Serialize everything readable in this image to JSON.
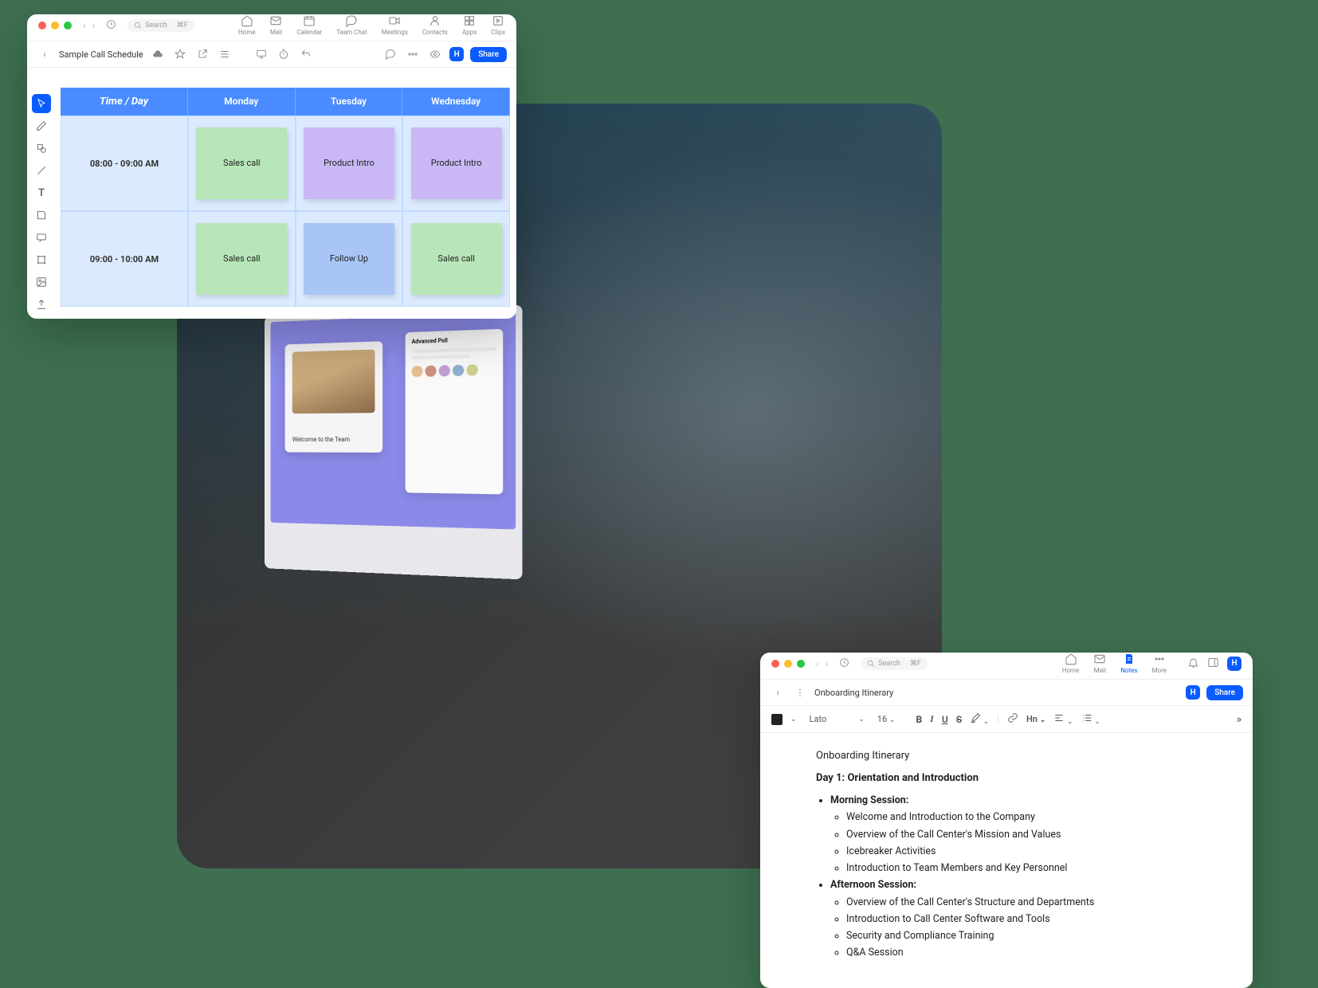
{
  "search": {
    "placeholder": "Search",
    "shortcut": "⌘F"
  },
  "nav_tabs": [
    "Home",
    "Mail",
    "Calendar",
    "Team Chat",
    "Meetings",
    "Contacts",
    "Apps",
    "Clips"
  ],
  "schedule": {
    "title": "Sample Call Schedule",
    "share": "Share",
    "header_time": "Time / Day",
    "days": [
      "Monday",
      "Tuesday",
      "Wednesday"
    ],
    "rows": [
      {
        "time": "08:00 - 09:00 AM",
        "cells": [
          {
            "label": "Sales call",
            "color": "green"
          },
          {
            "label": "Product Intro",
            "color": "purple"
          },
          {
            "label": "Product Intro",
            "color": "purple"
          }
        ]
      },
      {
        "time": "09:00 - 10:00 AM",
        "cells": [
          {
            "label": "Sales call",
            "color": "green"
          },
          {
            "label": "Follow Up",
            "color": "blue"
          },
          {
            "label": "Sales call",
            "color": "green"
          }
        ]
      }
    ]
  },
  "notes": {
    "nav_tabs": [
      "Home",
      "Mail",
      "Notes",
      "More"
    ],
    "active_tab": "Notes",
    "doc_title": "Onboarding Itinerary",
    "share": "Share",
    "font": "Lato",
    "size": "16",
    "heading": "Onboarding Itinerary",
    "day": "Day 1: Orientation and Introduction",
    "sessions": [
      {
        "name": "Morning Session:",
        "items": [
          "Welcome and Introduction to the Company",
          "Overview of the Call Center's Mission and Values",
          "Icebreaker Activities",
          "Introduction to Team Members and Key Personnel"
        ]
      },
      {
        "name": "Afternoon Session:",
        "items": [
          "Overview of the Call Center's Structure and Departments",
          "Introduction to Call Center Software and Tools",
          "Security and Compliance Training",
          "Q&A Session"
        ]
      }
    ]
  },
  "monitor": {
    "card_text": "Welcome to the Team",
    "panel_title": "Advanced Poll"
  },
  "avatar": "H"
}
